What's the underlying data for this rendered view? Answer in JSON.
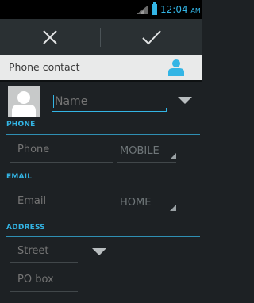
{
  "status": {
    "time": "12:04",
    "ampm": "AM"
  },
  "toolbar": {
    "cancel": "close-icon",
    "done": "check-icon"
  },
  "account": {
    "label": "Phone contact",
    "icon": "person-icon"
  },
  "name": {
    "placeholder": "Name"
  },
  "phone": {
    "section_label": "PHONE",
    "placeholder": "Phone",
    "type": "MOBILE"
  },
  "email": {
    "section_label": "EMAIL",
    "placeholder": "Email",
    "type": "HOME"
  },
  "address": {
    "section_label": "ADDRESS",
    "street_placeholder": "Street",
    "pobox_placeholder": "PO box"
  },
  "colors": {
    "accent": "#33b5e5",
    "background": "#1d2124",
    "account_bar": "#e9eaea"
  }
}
